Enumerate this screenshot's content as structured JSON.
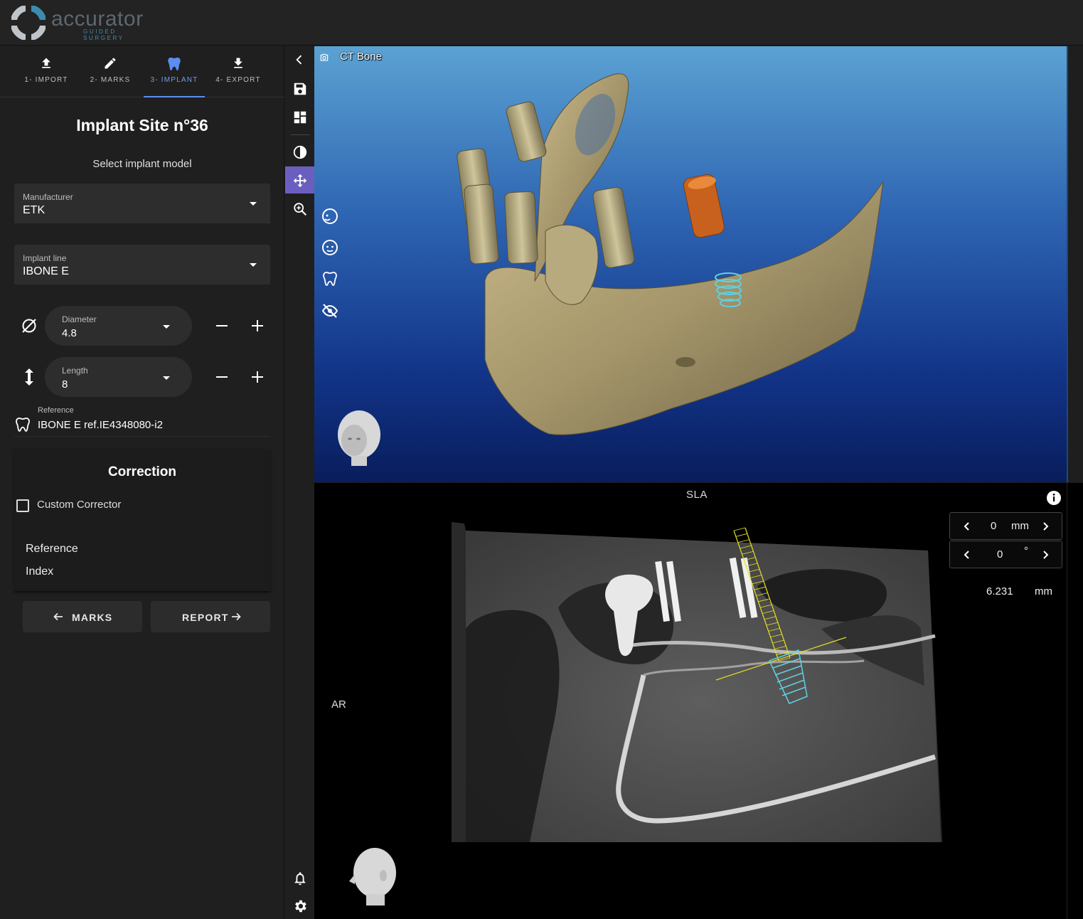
{
  "app": {
    "logo_text": "accurator",
    "logo_sub": "GUIDED SURGERY"
  },
  "steps": [
    {
      "label": "1- IMPORT",
      "icon": "upload-icon"
    },
    {
      "label": "2- MARKS",
      "icon": "pencil-icon"
    },
    {
      "label": "3- IMPLANT",
      "icon": "tooth-icon",
      "active": true
    },
    {
      "label": "4- EXPORT",
      "icon": "download-icon"
    }
  ],
  "panel": {
    "title": "Implant Site n°36",
    "subtitle": "Select implant model",
    "manufacturer": {
      "label": "Manufacturer",
      "value": "ETK"
    },
    "implant_line": {
      "label": "Implant line",
      "value": "IBONE E"
    },
    "diameter": {
      "label": "Diameter",
      "value": "4.8",
      "icon": "diameter-icon"
    },
    "length": {
      "label": "Length",
      "value": "8",
      "icon": "vertical-arrows-icon"
    },
    "reference": {
      "label": "Reference",
      "value": "IBONE E ref.IE4348080-i2",
      "icon": "tooth-outline-icon"
    },
    "correction": {
      "title": "Correction",
      "custom_corrector_label": "Custom Corrector",
      "custom_corrector_checked": false,
      "items": [
        "Reference",
        "Index"
      ]
    },
    "nav": {
      "back_label": "MARKS",
      "next_label": "REPORT"
    }
  },
  "toolbar": {
    "icons": [
      "chevron-left-icon",
      "save-icon",
      "dashboard-icon",
      "contrast-icon",
      "move-icon",
      "zoom-in-icon",
      "bell-icon",
      "settings-icon"
    ],
    "active": "move-icon"
  },
  "view3d": {
    "title": "CT Bone",
    "overlay_icons": [
      "face-side-icon",
      "face-front-icon",
      "tooth-outline-icon",
      "eye-off-icon"
    ]
  },
  "view2d": {
    "top_label": "SLA",
    "left_label": "AR",
    "offset": {
      "value": "0",
      "unit": "mm"
    },
    "angle": {
      "value": "0",
      "unit": "°"
    },
    "measurement": {
      "value": "6.231",
      "unit": "mm"
    }
  },
  "colors": {
    "accent": "#5b8ef0",
    "active_tool": "#6a5fbf",
    "implant": "#5fd0e0",
    "guide": "#e8e020"
  }
}
